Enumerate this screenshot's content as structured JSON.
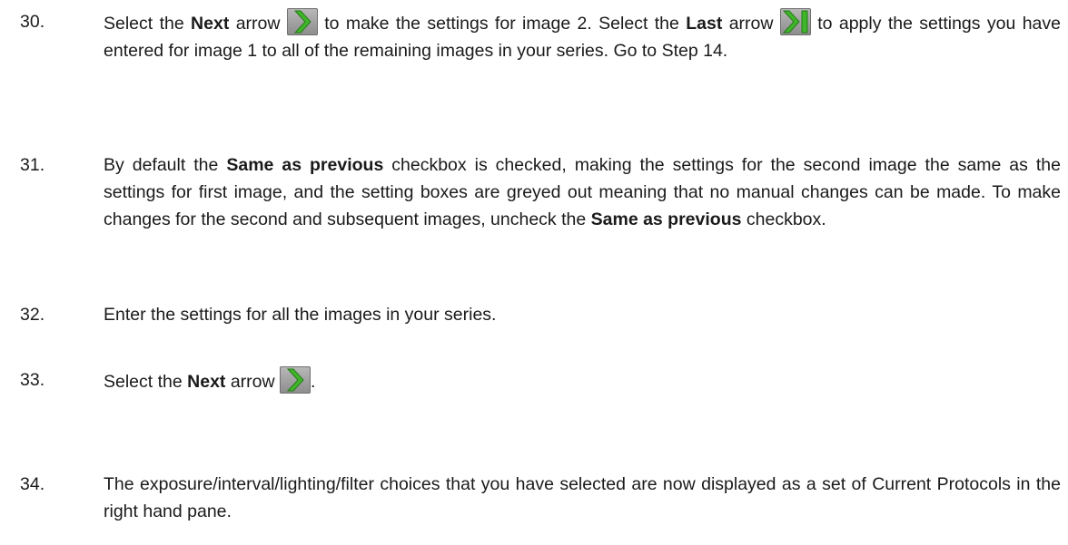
{
  "steps": [
    {
      "number": "30.",
      "segments": [
        {
          "text": "Select the "
        },
        {
          "text": "Next",
          "bold": true
        },
        {
          "text": " arrow "
        },
        {
          "icon": "next-arrow-icon"
        },
        {
          "text": " to make the settings for image 2. Select the "
        },
        {
          "text": "Last",
          "bold": true
        },
        {
          "text": " arrow "
        },
        {
          "icon": "last-arrow-icon"
        },
        {
          "text": " to apply the settings you have entered for image 1 to all of the remaining images in your series. Go to Step 14."
        }
      ]
    },
    {
      "number": "31.",
      "segments": [
        {
          "text": "By default the "
        },
        {
          "text": "Same as previous",
          "bold": true
        },
        {
          "text": " checkbox is checked, making the settings for the second image the same as the settings for first image, and the setting boxes are greyed out meaning that no manual changes can be made. To make changes for the second and subsequent images, uncheck the "
        },
        {
          "text": "Same as previous",
          "bold": true
        },
        {
          "text": " checkbox."
        }
      ]
    },
    {
      "number": "32.",
      "segments": [
        {
          "text": "Enter the settings for all the images in your series."
        }
      ]
    },
    {
      "number": "33.",
      "segments": [
        {
          "text": "Select the "
        },
        {
          "text": "Next",
          "bold": true
        },
        {
          "text": " arrow "
        },
        {
          "icon": "next-arrow-icon"
        },
        {
          "text": "."
        }
      ]
    },
    {
      "number": "34.",
      "segments": [
        {
          "text": "The exposure/interval/lighting/filter choices that you have selected are now displayed as a set of Current Protocols in the right hand pane."
        }
      ]
    }
  ],
  "colors": {
    "text": "#1a1a1a",
    "arrow_green": "#3fb52a",
    "arrow_bg": "#9f9f9f"
  }
}
